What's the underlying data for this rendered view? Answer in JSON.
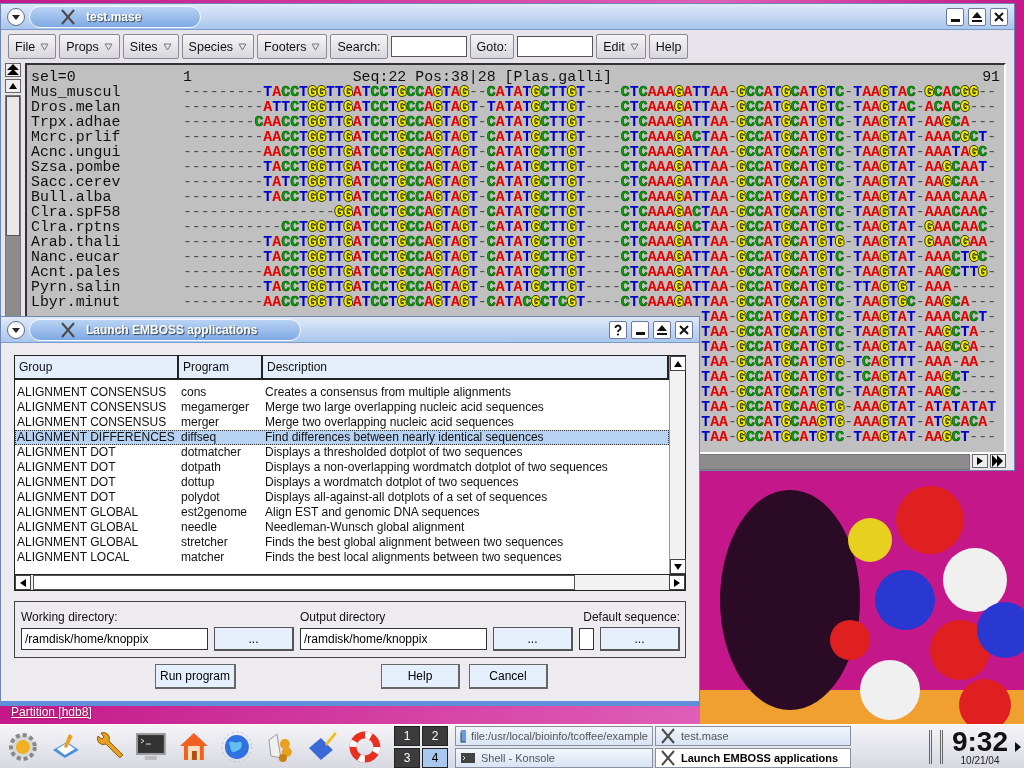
{
  "main_window": {
    "title": "test.mase",
    "toolbar": [
      {
        "kind": "menu",
        "label": "File"
      },
      {
        "kind": "menu",
        "label": "Props"
      },
      {
        "kind": "menu",
        "label": "Sites"
      },
      {
        "kind": "menu",
        "label": "Species"
      },
      {
        "kind": "menu",
        "label": "Footers"
      },
      {
        "kind": "button",
        "label": "Search:"
      },
      {
        "kind": "field"
      },
      {
        "kind": "button",
        "label": "Goto:"
      },
      {
        "kind": "field"
      },
      {
        "kind": "menu",
        "label": "Edit"
      },
      {
        "kind": "button",
        "label": "Help"
      }
    ],
    "alignment": {
      "selection": "sel=0",
      "start_column": "1",
      "position": "Seq:22 Pos:38|28 [Plas.galli]",
      "end_column": "91",
      "rows": [
        {
          "name": "Mus_muscul",
          "sequence": "---------TACCTGGTTGATCCTGCCAGTAG--CATATGCTTGT----CTCAAAGATTAA-GCCATGCATGTC-TAAGTAC-GCACGG--"
        },
        {
          "name": "Dros.melan",
          "sequence": "---------ATTCTGGTTGATCCTGCCAGTAGT-TATATGCTTGT----CTCAAAGATTAA-GCCATGCATGTC-TAAGTAC-ACACG---"
        },
        {
          "name": "Trpx.adhae",
          "sequence": "--------CAACCTGGTTGATCCTGCCAGTAGT-CATATGCTTGT----CTCAAAGATTAA-GCCATGCATGTC-TAAGTAT-AAGCA---"
        },
        {
          "name": "Mcrc.prlif",
          "sequence": "---------AACCTGGTTGATCCTGCCAGTAGT-CATATGCTTGT----CTCAAAGACTAA-GCCATGCATGTC-TAAGTAT-AAACGCT-"
        },
        {
          "name": "Acnc.ungui",
          "sequence": "---------AACCTGGTTGATCCTGCCAGTAGT-CATATGCTTGT----CTCAAAGATTAA-GCCATGCATGTC-TAAGTAT-AAATAGC-"
        },
        {
          "name": "Szsa.pombe",
          "sequence": "---------TACCTGGTTGATCCTGCCAGTAGT-CATATGCTTGT----CTCAAAGATTAA-GCCATGCATGTC-TAAGTAT-AAGCAAT-"
        },
        {
          "name": "Sacc.cerev",
          "sequence": "---------TATCTGGTTGATCCTGCCAGTAGT-CATATGCTTGT----CTCAAAGATTAA-GCCATGCATGTC-TAAGTAT-AAGCAA--"
        },
        {
          "name": "Bull.alba",
          "sequence": "---------TACCTGGTTGATCCTGCCAGTAGT-CATATGCTTGT----CTCAAAGATTAA-GCCATGCATGTC-TAAGTAT-AAACAAA-"
        },
        {
          "name": "Clra.spF58",
          "sequence": "-----------------GGATCCTGCCAGTAGT-CATATGCTTGT----CTCAAAGACTAA-GCCATGCATGTC-TAAGTAT-AAACAAC-"
        },
        {
          "name": "Clra.rptns",
          "sequence": "-----------CCTGGTTGATCCTGCCAGTAGT-CATATGCTTGT----CTCAAAGACTAA-GCCATGCATGTC-TAAGTAT-GAACAAC-"
        },
        {
          "name": "Arab.thali",
          "sequence": "---------TACCTGGTTGATCCTGCCAGTAGT-CATATGCTTGT----CTCAAAGATTAA-GCCATGCATGTG-TAAGTAT-GAACGAA-"
        },
        {
          "name": "Nanc.eucar",
          "sequence": "---------TACCTGGTTGATCCTGCCAGTAGT-CATATGCTTGT----CTCAAAGATTAA-GCCATGCATGTC-TAAGTAT-AAACTGC-"
        },
        {
          "name": "Acnt.pales",
          "sequence": "---------AACCTGGTTGATCCTGCCAGTAGT-CATATGCTTGT----CTCAAAGATTAA-GCCATGCATGTC-TAAGTAT-AAGCTTG-"
        },
        {
          "name": "Pyrn.salin",
          "sequence": "---------TACCTGGTTGATCCTGCCAGTAGT-CATATGCTTGT----CTCAAAGATTAA-GCCATGCATGTC-TTAGTGT-AAA-----"
        },
        {
          "name": "Lbyr.minut",
          "sequence": "---------AACCTGGTTGATCCTGCCAGTAGT-CATACGCTCGT----CTCAAAGATTAA-GCCATGCATGTC-TAAGTGC-AAGCA---"
        }
      ],
      "covered_rows_tail": [
        "TAA-GCCATGCATGTC-TAAGTAT-AAACACT-",
        "TAA-GCCATGCATGTC-TAAGTAT-AAGCTA--",
        "TAA-GCCATGCATGTC-TAAGTAT-AAGCGA--",
        "TAA-GCCATGCATGTG-TCAGTTT-AAA-AA--",
        "TAA-GCCATGCATGTC-TCAGTAT-AAGCT---",
        "TAA-GCCATGCATGTC-TAAGTAT-AAGC----",
        "TAA-GCCATGCAAGTG-AAAGTAT-ATATATAT",
        "TAA-GCCATGCAAGTG-AAAGTAT-ATGCACA-",
        "TAA-GCCATGCATGTC-TAAGTAT-AAGCT---"
      ]
    }
  },
  "dialog": {
    "title": "Launch EMBOSS applications",
    "columns": [
      "Group",
      "Program",
      "Description"
    ],
    "programs": [
      {
        "group": "ALIGNMENT CONSENSUS",
        "program": "cons",
        "description": "Creates a consensus from multiple alignments",
        "selected": false
      },
      {
        "group": "ALIGNMENT CONSENSUS",
        "program": "megamerger",
        "description": "Merge two large overlapping nucleic acid sequences",
        "selected": false
      },
      {
        "group": "ALIGNMENT CONSENSUS",
        "program": "merger",
        "description": "Merge two overlapping nucleic acid sequences",
        "selected": false
      },
      {
        "group": "ALIGNMENT DIFFERENCES",
        "program": "diffseq",
        "description": "Find differences between nearly identical sequences",
        "selected": true
      },
      {
        "group": "ALIGNMENT DOT",
        "program": "dotmatcher",
        "description": "Displays a thresholded dotplot of two sequences",
        "selected": false
      },
      {
        "group": "ALIGNMENT DOT",
        "program": "dotpath",
        "description": "Displays a non-overlapping wordmatch dotplot of two sequences",
        "selected": false
      },
      {
        "group": "ALIGNMENT DOT",
        "program": "dottup",
        "description": "Displays a wordmatch dotplot of two sequences",
        "selected": false
      },
      {
        "group": "ALIGNMENT DOT",
        "program": "polydot",
        "description": "Displays all-against-all dotplots of a set of sequences",
        "selected": false
      },
      {
        "group": "ALIGNMENT GLOBAL",
        "program": "est2genome",
        "description": "Align EST and genomic DNA sequences",
        "selected": false
      },
      {
        "group": "ALIGNMENT GLOBAL",
        "program": "needle",
        "description": "Needleman-Wunsch global alignment",
        "selected": false
      },
      {
        "group": "ALIGNMENT GLOBAL",
        "program": "stretcher",
        "description": "Finds the best global alignment between two sequences",
        "selected": false
      },
      {
        "group": "ALIGNMENT LOCAL",
        "program": "matcher",
        "description": "Finds the best local alignments between two sequences",
        "selected": false
      }
    ],
    "working_directory": {
      "label": "Working directory:",
      "value": "/ramdisk/home/knoppix",
      "browse": "..."
    },
    "output_directory": {
      "label": "Output directory",
      "value": "/ramdisk/home/knoppix",
      "browse": "..."
    },
    "default_sequence": {
      "label": "Default sequence:",
      "checked": false,
      "browse": "..."
    },
    "buttons": [
      "Run program",
      "Help",
      "Cancel"
    ]
  },
  "desktop": {
    "link": "Partition [hdb8]"
  },
  "taskbar": {
    "desktops": [
      {
        "label": "1",
        "selected": false
      },
      {
        "label": "2",
        "selected": false
      },
      {
        "label": "3",
        "selected": false
      },
      {
        "label": "4",
        "selected": true
      }
    ],
    "tasks": [
      {
        "kind": "browser",
        "label": "file:/usr/local/bioinfo/tcoffee/example",
        "selected": false
      },
      {
        "kind": "x11",
        "label": "test.mase",
        "selected": false
      },
      {
        "kind": "terminal",
        "label": "Shell - Konsole",
        "selected": false
      },
      {
        "kind": "x11",
        "label": "Launch EMBOSS applications",
        "selected": true
      }
    ],
    "time": "9:32",
    "date": "10/21/04"
  }
}
